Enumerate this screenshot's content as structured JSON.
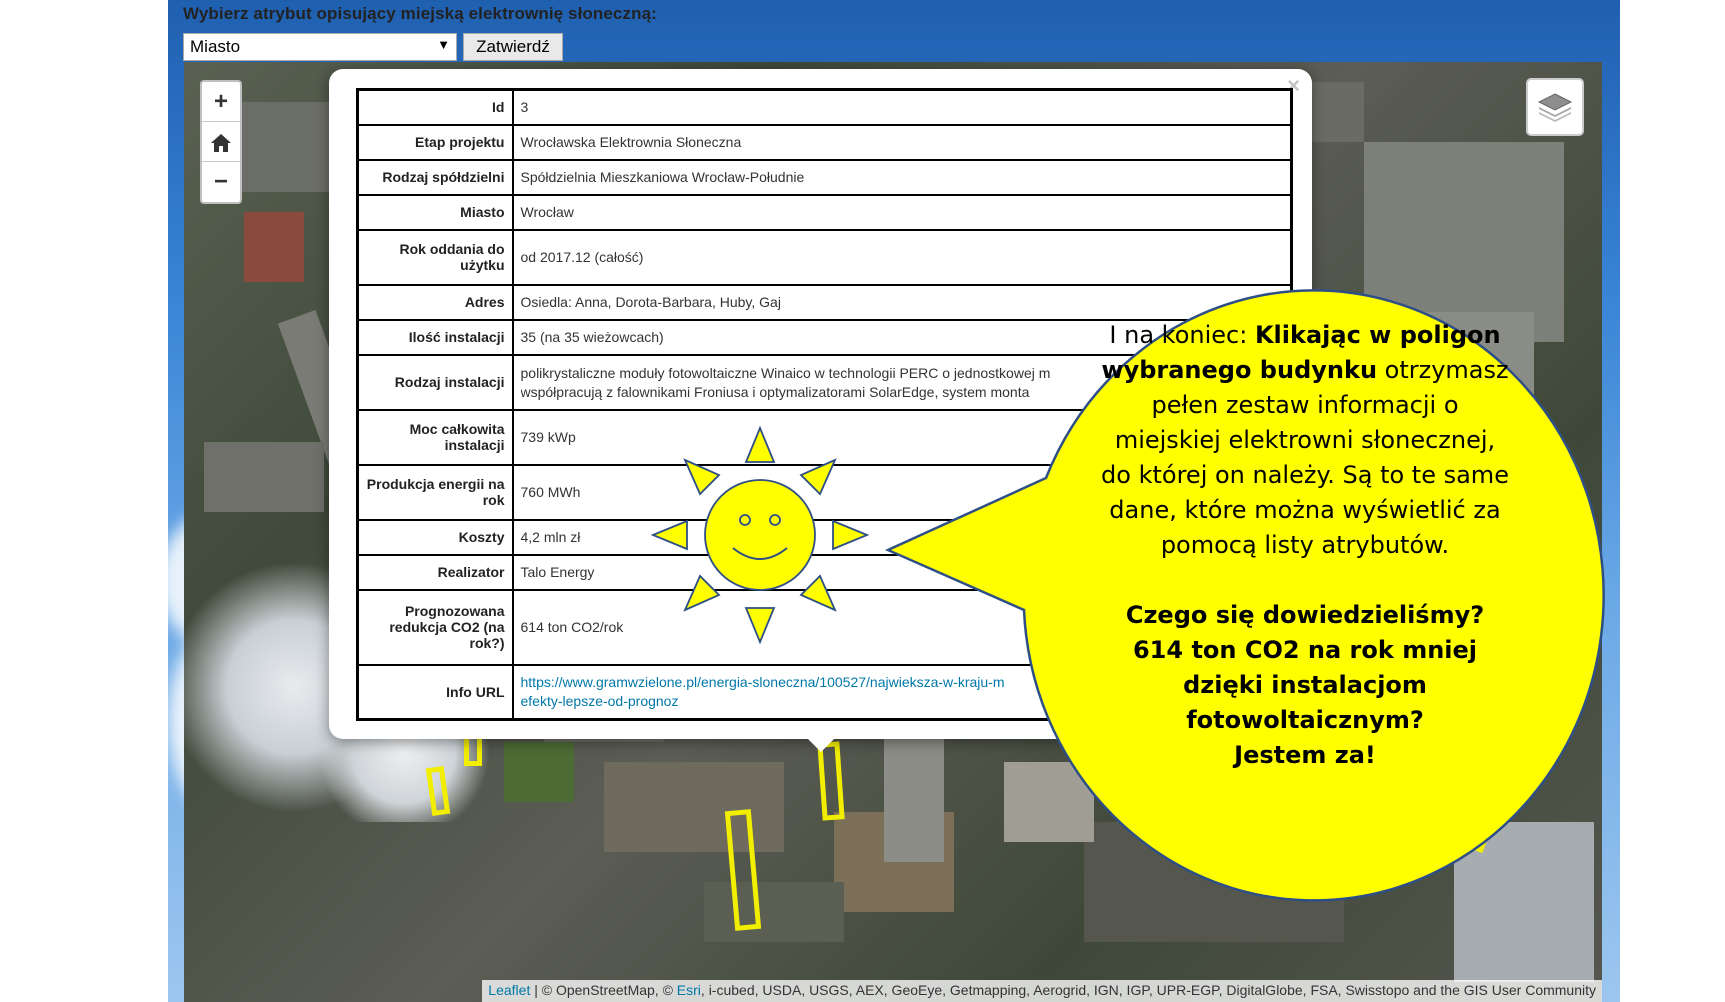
{
  "attribute_bar": {
    "prompt": "Wybierz atrybut opisujący miejską elektrownię słoneczną:",
    "selected_value": "Miasto",
    "submit_label": "Zatwierdź"
  },
  "map_controls": {
    "zoom_in": "+",
    "zoom_out": "−"
  },
  "popup": {
    "close_label": "×",
    "rows": [
      {
        "key": "Id",
        "value": "3"
      },
      {
        "key": "Etap projektu",
        "value": "Wrocławska Elektrownia Słoneczna"
      },
      {
        "key": "Rodzaj spółdzielni",
        "value": "Spółdzielnia Mieszkaniowa Wrocław-Południe"
      },
      {
        "key": "Miasto",
        "value": "Wrocław"
      },
      {
        "key": "Rok oddania do użytku",
        "value": "od 2017.12 (całość)"
      },
      {
        "key": "Adres",
        "value": "Osiedla: Anna, Dorota-Barbara, Huby, Gaj"
      },
      {
        "key": "Ilość instalacji",
        "value": "35 (na 35 wieżowcach)"
      },
      {
        "key": "Rodzaj instalacji",
        "value_line1": "polikrystaliczne moduły fotowoltaiczne Winaico w technologii PERC o jednostkowej m",
        "value_line2": "współpracują z falownikami Froniusa i optymalizatorami SolarEdge, system monta"
      },
      {
        "key": "Moc całkowita instalacji",
        "value": "739 kWp"
      },
      {
        "key": "Produkcja energii na rok",
        "value": "760 MWh"
      },
      {
        "key": "Koszty",
        "value": "4,2 mln zł"
      },
      {
        "key": "Realizator",
        "value": "Talo Energy"
      },
      {
        "key": "Prognozowana redukcja CO2 (na rok?)",
        "value": "614 ton CO2/rok"
      },
      {
        "key": "Info URL",
        "value_line1": "https://www.gramwzielone.pl/energia-sloneczna/100527/najwieksza-w-kraju-m",
        "value_line2": "efekty-lepsze-od-prognoz"
      }
    ]
  },
  "bubble": {
    "intro_plain": "I na koniec: ",
    "intro_bold": "Klikając w poligon wybranego budynku",
    "intro_rest": " otrzymasz pełen zestaw informacji o miejskiej elektrowni słonecznej, do której on należy. Są to te same dane, które można wyświetlić za pomocą listy atrybutów.",
    "summary_line1": "Czego się dowiedzieliśmy?",
    "summary_line2": "614 ton CO2 na rok mniej",
    "summary_line3": "dzięki instalacjom",
    "summary_line4": "fotowoltaicznym?",
    "summary_line5": "Jestem za!",
    "color": "#ffff00"
  },
  "attribution": {
    "leaflet": "Leaflet",
    "text1": " | © OpenStreetMap, © ",
    "esri": "Esri",
    "text2": ", i-cubed, USDA, USGS, AEX, GeoEye, Getmapping, Aerogrid, IGN, IGP, UPR-EGP, DigitalGlobe, FSA, Swisstopo and the GIS User Community"
  },
  "colors": {
    "building_outline": "#f2ee00",
    "link": "#0078a8"
  }
}
